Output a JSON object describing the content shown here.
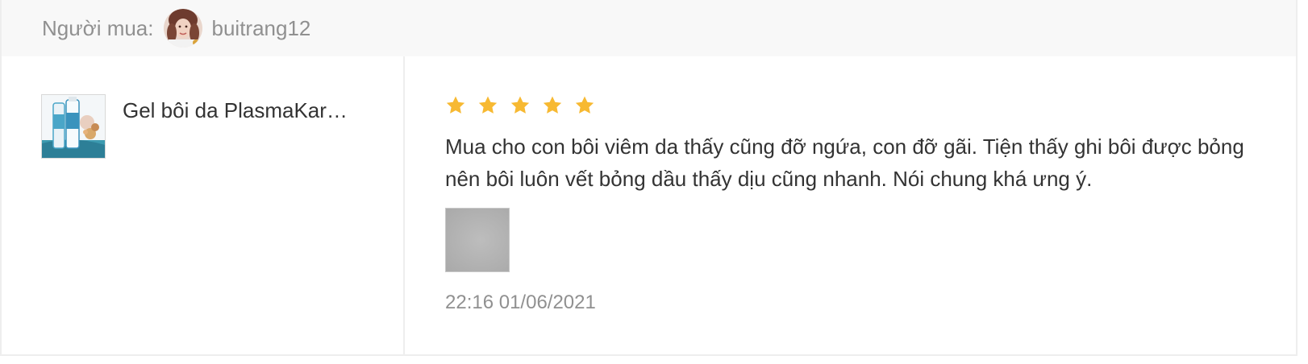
{
  "buyer": {
    "label": "Người mua:",
    "username": "buitrang12",
    "avatar_icon": "user-avatar-photo"
  },
  "product": {
    "name": "Gel bôi da PlasmaKar…",
    "thumbnail_icon": "product-tube-image"
  },
  "review": {
    "rating": 5,
    "max_rating": 5,
    "star_color": "#f7b932",
    "text": "Mua cho con bôi viêm da thấy cũng đỡ ngứa, con đỡ gãi. Tiện thấy ghi bôi được bỏng nên bôi luôn vết bỏng dầu thấy dịu cũng nhanh. Nói chung khá ưng ý.",
    "photo_icon": "review-photo-thumbnail",
    "timestamp": "22:16 01/06/2021"
  }
}
